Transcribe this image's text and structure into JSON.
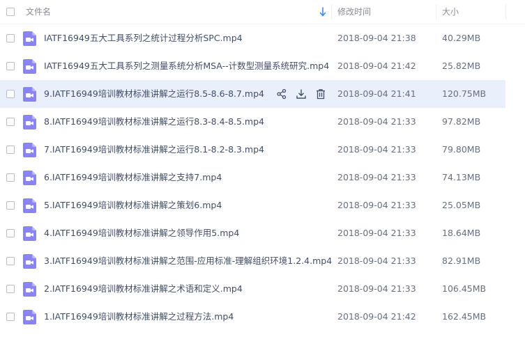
{
  "header": {
    "name_label": "文件名",
    "time_label": "修改时间",
    "size_label": "大小"
  },
  "colors": {
    "video_icon": "#8a84f2",
    "hover_row": "#e9f0fc",
    "sort_arrow": "#3b8cff"
  },
  "hover_row_index": 2,
  "files": [
    {
      "name": "IATF16949五大工具系列之统计过程分析SPC.mp4",
      "time": "2018-09-04 21:38",
      "size": "40.29MB"
    },
    {
      "name": "IATF16949五大工具系列之测量系统分析MSA--计数型测量系统研究.mp4",
      "time": "2018-09-04 21:42",
      "size": "25.82MB"
    },
    {
      "name": "9.IATF16949培训教材标准讲解之运行8.5-8.6-8.7.mp4",
      "time": "2018-09-04 21:41",
      "size": "120.75MB"
    },
    {
      "name": "8.IATF16949培训教材标准讲解之运行8.3-8.4-8.5.mp4",
      "time": "2018-09-04 21:33",
      "size": "97.82MB"
    },
    {
      "name": "7.IATF16949培训教材标准讲解之运行8.1-8.2-8.3.mp4",
      "time": "2018-09-04 21:33",
      "size": "79.80MB"
    },
    {
      "name": "6.IATF16949培训教材标准讲解之支持7.mp4",
      "time": "2018-09-04 21:33",
      "size": "74.13MB"
    },
    {
      "name": "5.IATF16949培训教材标准讲解之策划6.mp4",
      "time": "2018-09-04 21:33",
      "size": "25.05MB"
    },
    {
      "name": "4.IATF16949培训教材标准讲解之领导作用5.mp4",
      "time": "2018-09-04 21:33",
      "size": "18.64MB"
    },
    {
      "name": "3.IATF16949培训教材标准讲解之范围-应用标准-理解组织环境1.2.4.mp4",
      "time": "2018-09-04 21:33",
      "size": "82.91MB"
    },
    {
      "name": "2.IATF16949培训教材标准讲解之术语和定义.mp4",
      "time": "2018-09-04 21:33",
      "size": "106.45MB"
    },
    {
      "name": "1.IATF16949培训教材标准讲解之过程方法.mp4",
      "time": "2018-09-04 21:42",
      "size": "162.45MB"
    }
  ]
}
